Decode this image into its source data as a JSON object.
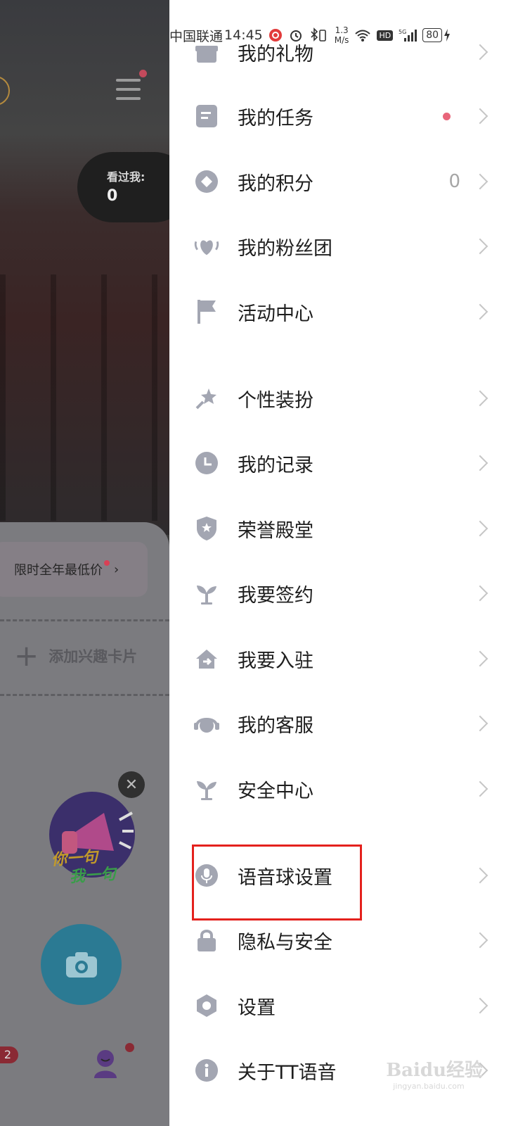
{
  "status_bar": {
    "carrier": "中国联通",
    "time": "14:45",
    "speed_value": "1.3",
    "speed_unit": "M/s",
    "network": "5G",
    "hd_label": "HD",
    "battery": "80"
  },
  "background_app": {
    "seen_label": "看过我:",
    "seen_count": "0",
    "promo_text": "限时全年最低价",
    "add_card_label": "添加兴趣卡片",
    "sticker_line1": "你一句",
    "sticker_line2": "我一句",
    "unread_badge": "2"
  },
  "drawer": {
    "items": [
      {
        "label": "我的礼物",
        "icon": "gift-icon"
      },
      {
        "label": "我的任务",
        "icon": "task-icon",
        "dot": true
      },
      {
        "label": "我的积分",
        "icon": "points-icon",
        "value": "0"
      },
      {
        "label": "我的粉丝团",
        "icon": "fan-heart-icon"
      },
      {
        "label": "活动中心",
        "icon": "flag-icon"
      },
      {
        "label": "个性装扮",
        "icon": "magic-wand-icon"
      },
      {
        "label": "我的记录",
        "icon": "clock-icon"
      },
      {
        "label": "荣誉殿堂",
        "icon": "shield-star-icon"
      },
      {
        "label": "我要签约",
        "icon": "sprout-icon"
      },
      {
        "label": "我要入驻",
        "icon": "home-arrow-icon"
      },
      {
        "label": "我的客服",
        "icon": "headset-icon"
      },
      {
        "label": "安全中心",
        "icon": "sprout-icon"
      },
      {
        "label": "语音球设置",
        "icon": "microphone-icon"
      },
      {
        "label": "隐私与安全",
        "icon": "lock-icon"
      },
      {
        "label": "设置",
        "icon": "gear-icon"
      },
      {
        "label": "关于TT语音",
        "icon": "info-icon"
      }
    ]
  },
  "watermark": {
    "text": "Baidu经验",
    "sub": "jingyan.baidu.com"
  },
  "colors": {
    "icon_gray": "#a3a6b2",
    "red_dot": "#e8657a",
    "highlight_box": "#e4211d"
  }
}
